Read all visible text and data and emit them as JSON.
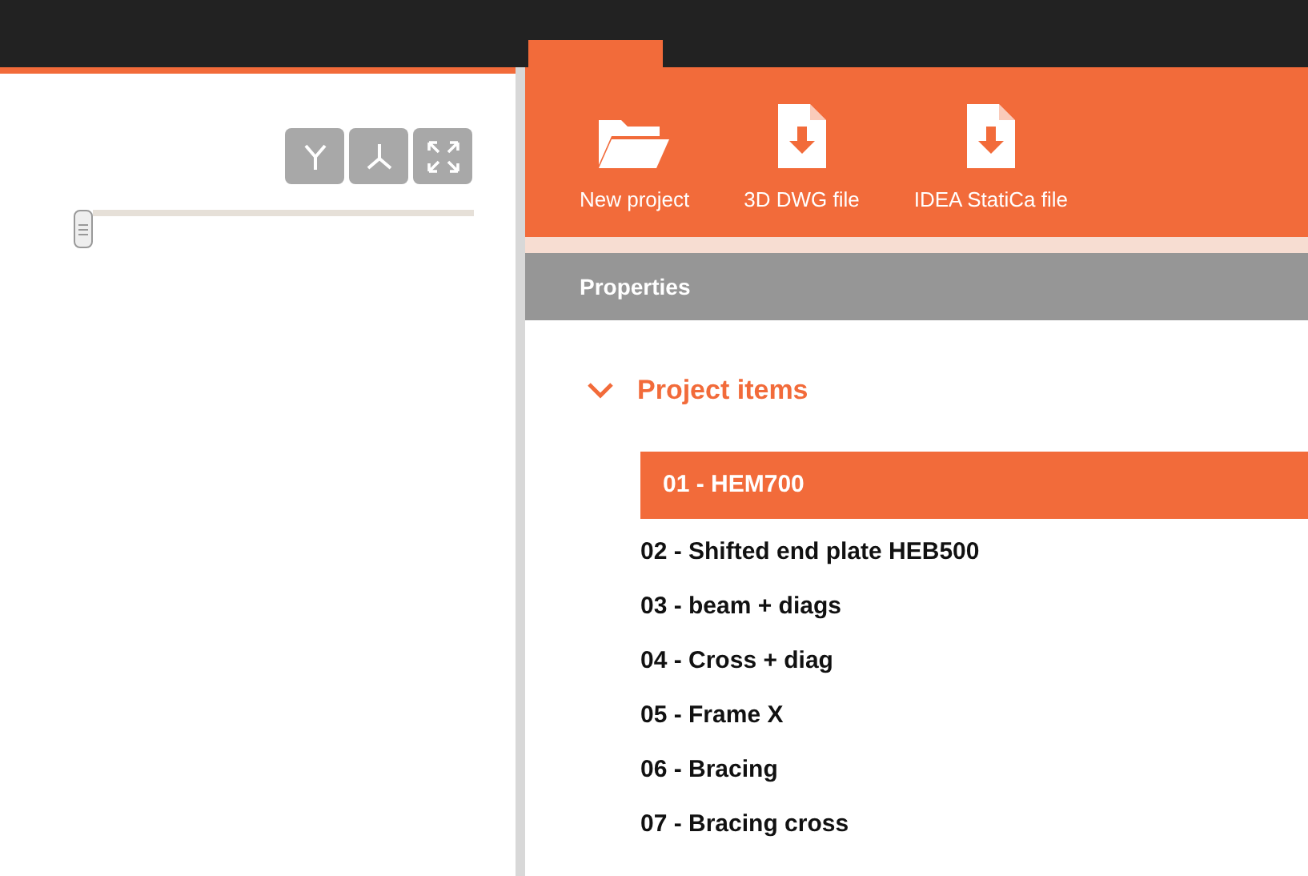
{
  "view_buttons": [
    {
      "kind": "y"
    },
    {
      "kind": "axes"
    },
    {
      "kind": "fit"
    }
  ],
  "toolbar": [
    {
      "label": "New project",
      "kind": "folder"
    },
    {
      "label": "3D DWG file",
      "kind": "file"
    },
    {
      "label": "IDEA StatiCa file",
      "kind": "file"
    }
  ],
  "properties": {
    "title": "Properties",
    "section": {
      "label": "Project items",
      "expanded": true
    },
    "items": [
      {
        "label": "01 - HEM700",
        "selected": true
      },
      {
        "label": "02 - Shifted end plate HEB500",
        "selected": false
      },
      {
        "label": "03 - beam + diags",
        "selected": false
      },
      {
        "label": "04 - Cross + diag",
        "selected": false
      },
      {
        "label": "05 - Frame X",
        "selected": false
      },
      {
        "label": "06 - Bracing",
        "selected": false
      },
      {
        "label": "07 - Bracing cross",
        "selected": false
      }
    ]
  }
}
